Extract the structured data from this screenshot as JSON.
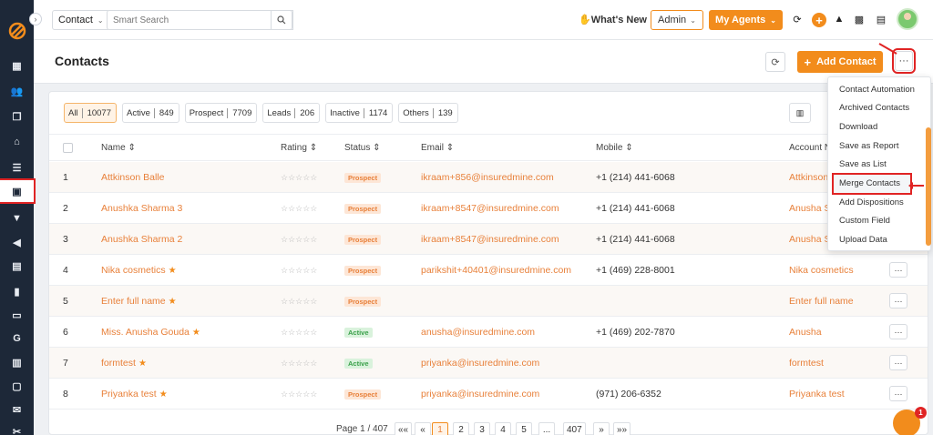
{
  "topbar": {
    "module_select": "Contact",
    "search_placeholder": "Smart Search",
    "whats_new": "What's New",
    "role_select": "Admin",
    "my_agents": "My Agents"
  },
  "page": {
    "title": "Contacts",
    "add_contact": "Add Contact"
  },
  "filters": [
    {
      "label": "All",
      "count": "10077",
      "active": true
    },
    {
      "label": "Active",
      "count": "849"
    },
    {
      "label": "Prospect",
      "count": "7709"
    },
    {
      "label": "Leads",
      "count": "206"
    },
    {
      "label": "Inactive",
      "count": "1174"
    },
    {
      "label": "Others",
      "count": "139"
    }
  ],
  "columns": [
    "Name",
    "Rating",
    "Status",
    "Email",
    "Mobile",
    "Account N"
  ],
  "rows": [
    {
      "num": "1",
      "name": "Attkinson Balle",
      "starred": false,
      "rating": "☆☆☆☆☆",
      "status": "Prospect",
      "email": "ikraam+856@insuredmine.com",
      "mobile": "+1 (214) 441-6068",
      "account": "Attkinson"
    },
    {
      "num": "2",
      "name": "Anushka Sharma 3",
      "starred": false,
      "rating": "☆☆☆☆☆",
      "status": "Prospect",
      "email": "ikraam+8547@insuredmine.com",
      "mobile": "+1 (214) 441-6068",
      "account": "Anusha S"
    },
    {
      "num": "3",
      "name": "Anushka Sharma 2",
      "starred": false,
      "rating": "☆☆☆☆☆",
      "status": "Prospect",
      "email": "ikraam+8547@insuredmine.com",
      "mobile": "+1 (214) 441-6068",
      "account": "Anusha S"
    },
    {
      "num": "4",
      "name": "Nika cosmetics",
      "starred": true,
      "rating": "☆☆☆☆☆",
      "status": "Prospect",
      "email": "parikshit+40401@insuredmine.com",
      "mobile": "+1 (469) 228-8001",
      "account": "Nika cosmetics"
    },
    {
      "num": "5",
      "name": "Enter full name",
      "starred": true,
      "rating": "☆☆☆☆☆",
      "status": "Prospect",
      "email": "",
      "mobile": "",
      "account": "Enter full name"
    },
    {
      "num": "6",
      "name": "Miss. Anusha Gouda",
      "starred": true,
      "rating": "☆☆☆☆☆",
      "status": "Active",
      "email": "anusha@insuredmine.com",
      "mobile": "+1 (469) 202-7870",
      "account": "Anusha"
    },
    {
      "num": "7",
      "name": "formtest",
      "starred": true,
      "rating": "☆☆☆☆☆",
      "status": "Active",
      "email": "priyanka@insuredmine.com",
      "mobile": "",
      "account": "formtest"
    },
    {
      "num": "8",
      "name": "Priyanka test",
      "starred": true,
      "rating": "☆☆☆☆☆",
      "status": "Prospect",
      "email": "priyanka@insuredmine.com",
      "mobile": "(971) 206-6352",
      "account": "Priyanka test"
    }
  ],
  "menu": [
    "Contact Automation",
    "Archived Contacts",
    "Download",
    "Save as Report",
    "Save as List",
    "Merge Contacts",
    "Add Dispositions",
    "Custom Field",
    "Upload Data"
  ],
  "pagination": {
    "label": "Page 1 / 407",
    "first": "««",
    "prev": "«",
    "pages": [
      "1",
      "2",
      "3",
      "4",
      "5",
      "...",
      "407"
    ],
    "next": "»",
    "last": "»»"
  },
  "chat_badge": "1",
  "colors": {
    "accent": "#f28c1c",
    "sidebar": "#1d2838",
    "highlight": "#e02424"
  }
}
